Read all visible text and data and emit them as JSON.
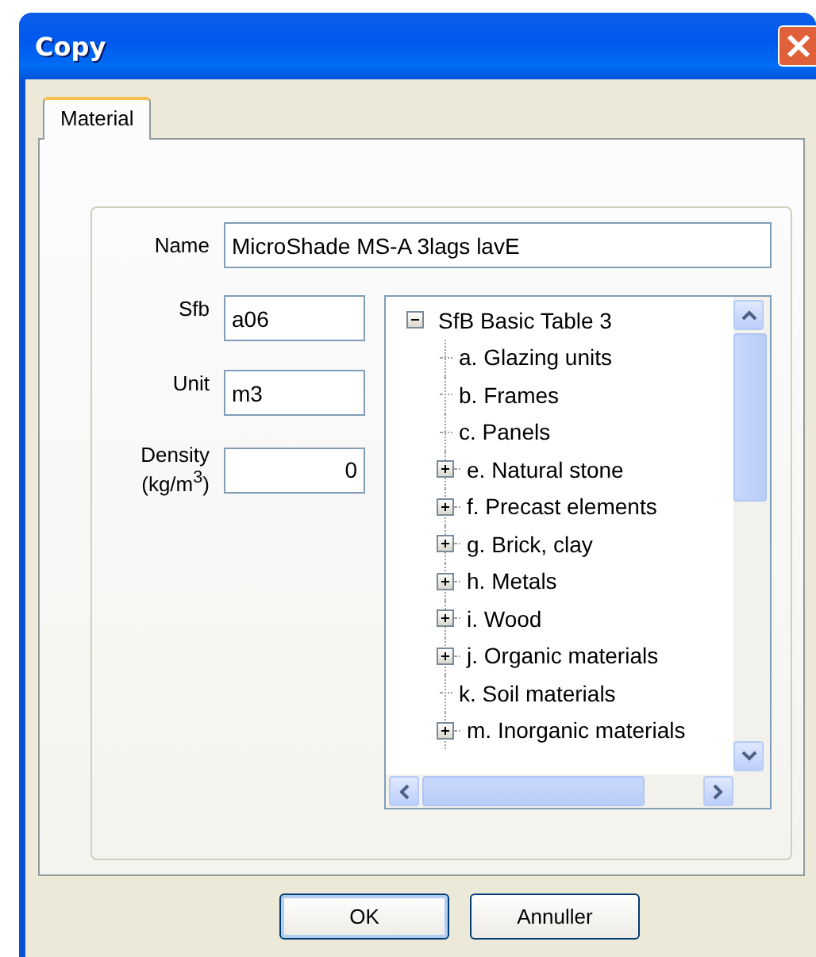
{
  "window": {
    "title": "Copy"
  },
  "tabs": [
    {
      "label": "Material",
      "selected": true
    }
  ],
  "form": {
    "name": {
      "label": "Name",
      "value": "MicroShade MS-A 3lags lavE"
    },
    "sfb": {
      "label": "Sfb",
      "value": "a06"
    },
    "unit": {
      "label": "Unit",
      "value": "m3"
    },
    "density": {
      "label": "Density (kg/m$^{3}$)",
      "value": "0"
    }
  },
  "tree": {
    "root": {
      "label": "SfB Basic Table 3",
      "expanded": true,
      "children": [
        {
          "label": "a. Glazing units",
          "kind": "leaf"
        },
        {
          "label": "b. Frames",
          "kind": "leaf"
        },
        {
          "label": "c. Panels",
          "kind": "leaf"
        },
        {
          "label": "e. Natural stone",
          "kind": "group",
          "expanded": false
        },
        {
          "label": "f. Precast elements",
          "kind": "group",
          "expanded": false
        },
        {
          "label": "g. Brick, clay",
          "kind": "group",
          "expanded": false
        },
        {
          "label": "h. Metals",
          "kind": "group",
          "expanded": false
        },
        {
          "label": "i. Wood",
          "kind": "group",
          "expanded": false
        },
        {
          "label": "j. Organic materials",
          "kind": "group",
          "expanded": false
        },
        {
          "label": "k. Soil materials",
          "kind": "leaf"
        },
        {
          "label": "m. Inorganic materials",
          "kind": "group",
          "expanded": false
        }
      ]
    }
  },
  "buttons": [
    {
      "label": "OK",
      "kind": "default"
    },
    {
      "label": "Annuller",
      "kind": "normal"
    }
  ]
}
